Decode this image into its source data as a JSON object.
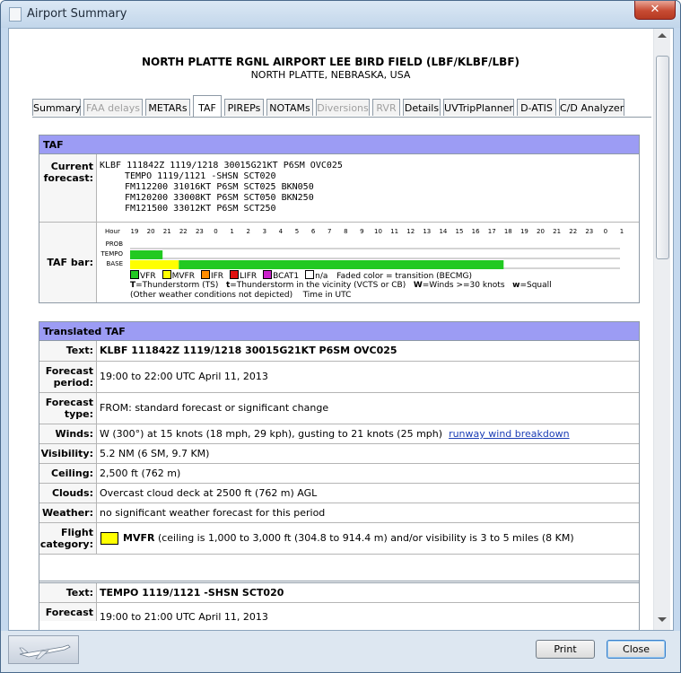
{
  "window": {
    "title": "Airport Summary",
    "close_label": "✕"
  },
  "airport": {
    "name": "NORTH PLATTE RGNL AIRPORT LEE BIRD FIELD (LBF/KLBF/LBF)",
    "location": "NORTH PLATTE, NEBRASKA, USA"
  },
  "tabs": [
    {
      "label": "Summary",
      "enabled": true
    },
    {
      "label": "FAA delays",
      "enabled": false
    },
    {
      "label": "METARs",
      "enabled": true
    },
    {
      "label": "TAF",
      "enabled": true,
      "active": true
    },
    {
      "label": "PIREPs",
      "enabled": true
    },
    {
      "label": "NOTAMs",
      "enabled": true
    },
    {
      "label": "Diversions",
      "enabled": false
    },
    {
      "label": "RVR",
      "enabled": false
    },
    {
      "label": "Details",
      "enabled": true
    },
    {
      "label": "UVTripPlanner",
      "enabled": true
    },
    {
      "label": "D-ATIS",
      "enabled": true
    },
    {
      "label": "C/D Analyzer",
      "enabled": true
    }
  ],
  "taf": {
    "section_title": "TAF",
    "current_label": "Current forecast:",
    "forecast_lines": [
      "KLBF 111842Z 1119/1218 30015G21KT P6SM OVC025",
      "TEMPO 1119/1121 -SHSN SCT020",
      "FM112200 31016KT P6SM SCT025 BKN050",
      "FM120200 33008KT P6SM SCT050 BKN250",
      "FM121500 33012KT P6SM SCT250"
    ],
    "bar_label": "TAF bar:",
    "hour_label": "Hour",
    "hours": [
      "19",
      "20",
      "21",
      "22",
      "23",
      "0",
      "1",
      "2",
      "3",
      "4",
      "5",
      "6",
      "7",
      "8",
      "9",
      "10",
      "11",
      "12",
      "13",
      "14",
      "15",
      "16",
      "17",
      "18",
      "19",
      "20",
      "21",
      "22",
      "23",
      "0",
      "1"
    ],
    "row_labels": [
      "PROB",
      "TEMPO",
      "BASE"
    ],
    "bars": [
      {
        "row": "TEMPO",
        "start_hour_index": 0,
        "end_hour_index": 2,
        "category": "VFR"
      },
      {
        "row": "BASE",
        "start_hour_index": 0,
        "end_hour_index": 3,
        "category": "MVFR"
      },
      {
        "row": "BASE",
        "start_hour_index": 3,
        "end_hour_index": 23,
        "category": "VFR"
      }
    ],
    "legend": [
      {
        "label": "VFR",
        "color": "#22c922"
      },
      {
        "label": "MVFR",
        "color": "#ffff00"
      },
      {
        "label": "IFR",
        "color": "#ff8c00"
      },
      {
        "label": "LIFR",
        "color": "#e01010"
      },
      {
        "label": "BCAT1",
        "color": "#cc22cc"
      },
      {
        "label": "n/a",
        "color": "#ffffff"
      }
    ],
    "legend_note": "Faded color = transition (BECMG)",
    "legend_line2": {
      "T": "T",
      "T_text": "=Thunderstorm (TS)",
      "t": "t",
      "t_text": "=Thunderstorm in the vicinity (VCTS or CB)",
      "W": "W",
      "W_text": "=Winds >=30 knots",
      "w": "w",
      "w_text": "=Squall"
    },
    "legend_line3": "(Other weather conditions not depicted)    Time in UTC"
  },
  "translated": {
    "section_title": "Translated TAF",
    "rows": [
      {
        "label": "Text:",
        "value": "KLBF 111842Z 1119/1218 30015G21KT P6SM OVC025"
      },
      {
        "label": "Forecast period:",
        "value": "19:00 to 22:00 UTC April 11, 2013"
      },
      {
        "label": "Forecast type:",
        "value": "FROM: standard forecast or significant change"
      },
      {
        "label": "Winds:",
        "value": "W (300°) at 15 knots (18 mph, 29 kph), gusting to 21 knots (25 mph)",
        "link": "runway wind breakdown"
      },
      {
        "label": "Visibility:",
        "value": "5.2 NM (6 SM, 9.7 KM)"
      },
      {
        "label": "Ceiling:",
        "value": "2,500 ft (762 m)"
      },
      {
        "label": "Clouds:",
        "value": "Overcast cloud deck at 2500 ft (762 m) AGL"
      },
      {
        "label": "Weather:",
        "value": "no significant weather forecast for this period"
      },
      {
        "label": "Flight category:",
        "value_bold": "MVFR",
        "value": " (ceiling is 1,000 to 3,000 ft (304.8 to 914.4 m) and/or visibility is 3 to 5 miles (8 KM)",
        "color": "#ffff00"
      }
    ],
    "second_text_label": "Text:",
    "second_text_value": "TEMPO 1119/1121 -SHSN SCT020",
    "second_period_label": "Forecast",
    "second_period_value": "19:00 to 21:00 UTC April 11, 2013"
  },
  "buttons": {
    "print": "Print",
    "close": "Close"
  }
}
